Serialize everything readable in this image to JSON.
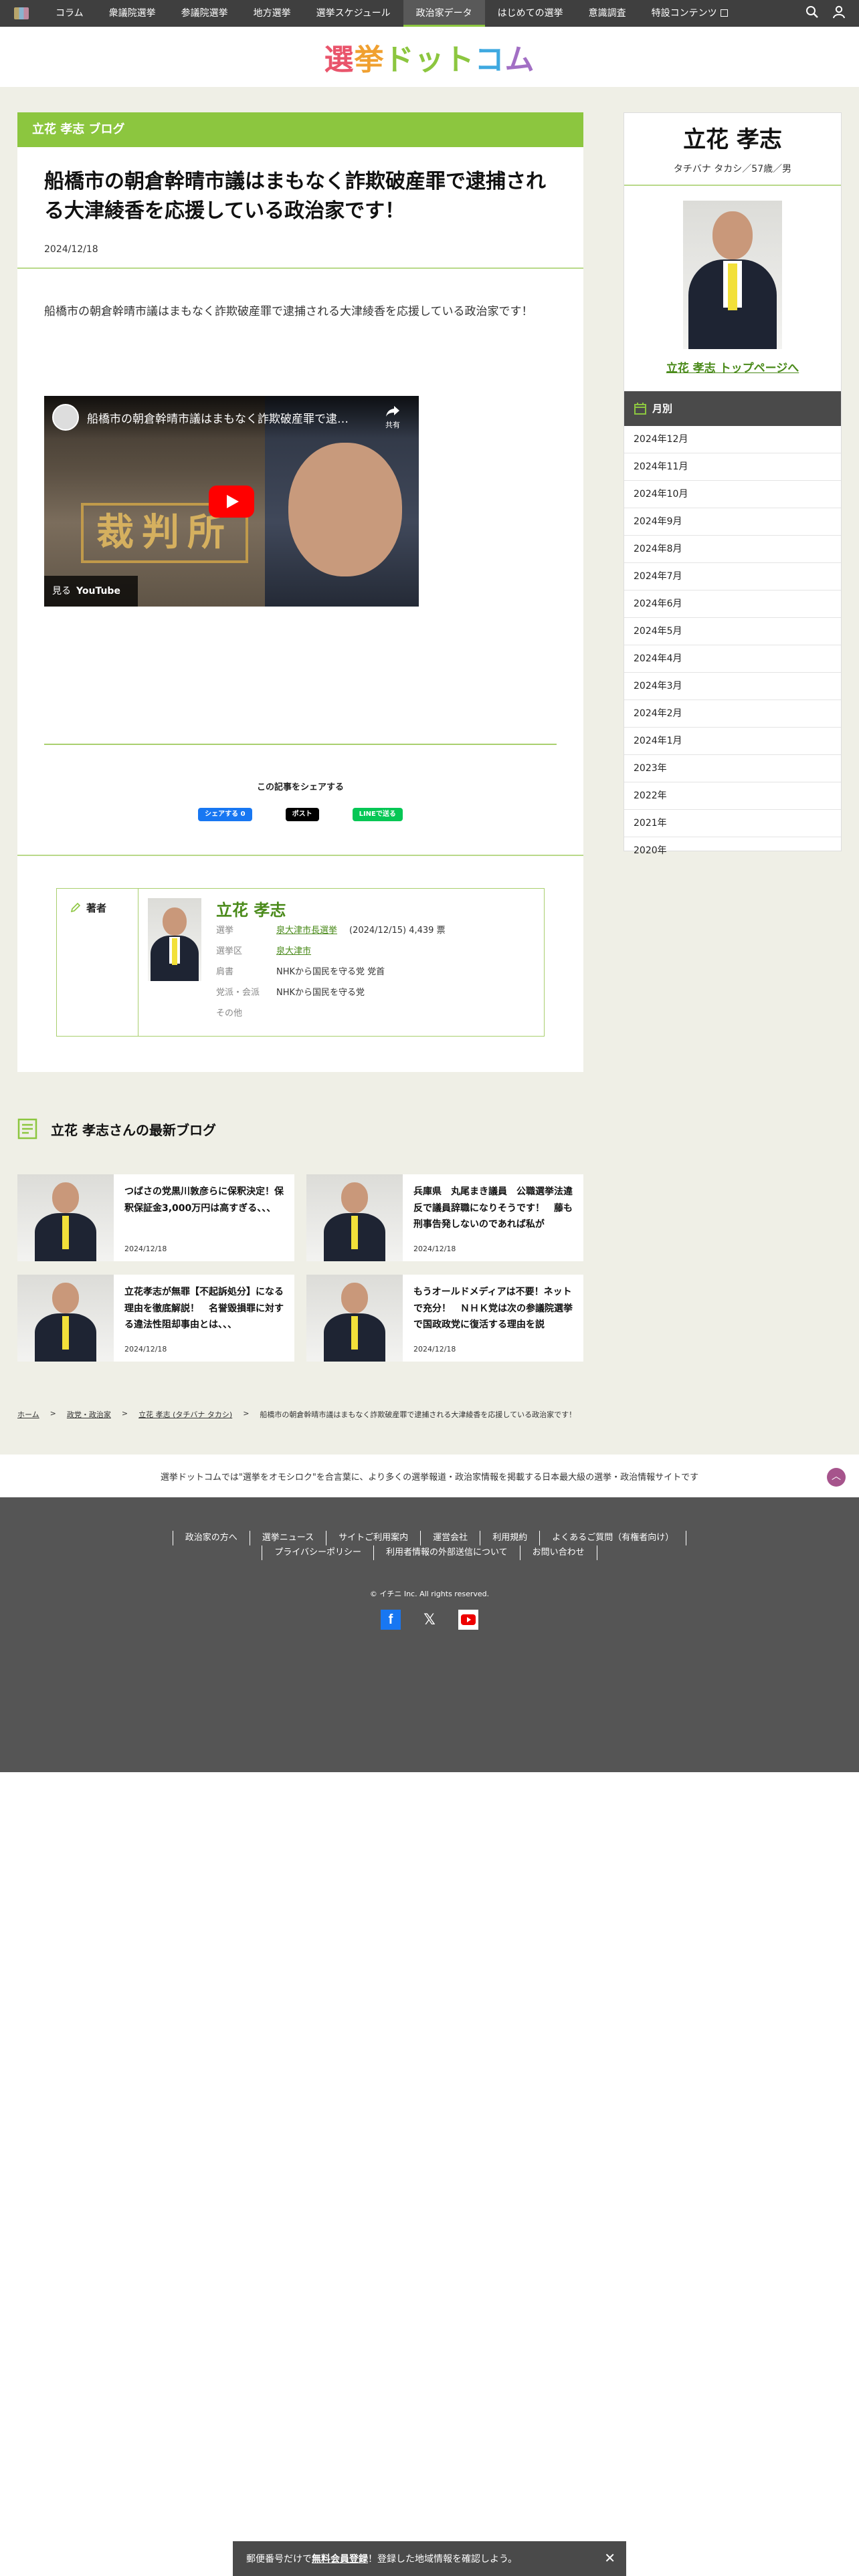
{
  "nav": {
    "items": [
      "コラム",
      "衆議院選挙",
      "参議院選挙",
      "地方選挙",
      "選挙スケジュール",
      "政治家データ",
      "はじめての選挙",
      "意識調査",
      "特設コンテンツ"
    ],
    "active_index": 5
  },
  "logo": {
    "parts": [
      "選",
      "挙",
      "ドット",
      "コ",
      "ム"
    ]
  },
  "article": {
    "blog_label": "立花 孝志 ブログ",
    "title": "船橋市の朝倉幹晴市議はまもなく詐欺破産罪で逮捕される大津綾香を応援している政治家です！",
    "date": "2024/12/18",
    "body": "船橋市の朝倉幹晴市議はまもなく詐欺破産罪で逮捕される大津綾香を応援している政治家です！",
    "video": {
      "title": "船橋市の朝倉幹晴市議はまもなく詐欺破産罪で逮…",
      "share_label": "共有",
      "watch_label": "見る",
      "youtube_label": "YouTube",
      "plaque_text": "裁判所"
    },
    "share_title": "この記事をシェアする",
    "share_buttons": {
      "facebook": "シェアする 0",
      "x": "ポスト",
      "line": "LINEで送る"
    }
  },
  "author": {
    "heading": "著者",
    "name": "立花 孝志",
    "labels": {
      "election": "選挙",
      "district": "選挙区",
      "party": "肩書",
      "faction": "党派・会派",
      "other": "その他"
    },
    "election_link": "泉大津市長選挙",
    "election_detail": "(2024/12/15) 4,439 票",
    "district": "泉大津市",
    "title_value": "NHKから国民を守る党 党首",
    "faction_value": "NHKから国民を守る党",
    "other_value": ""
  },
  "sidebar": {
    "name": "立花 孝志",
    "meta": "タチバナ タカシ／57歳／男",
    "top_link": "立花 孝志 トップページへ",
    "month_heading": "月別",
    "months": [
      "2024年12月",
      "2024年11月",
      "2024年10月",
      "2024年9月",
      "2024年8月",
      "2024年7月",
      "2024年6月",
      "2024年5月",
      "2024年4月",
      "2024年3月",
      "2024年2月",
      "2024年1月",
      "2023年",
      "2022年",
      "2021年",
      "2020年"
    ]
  },
  "latest": {
    "heading": "立花 孝志さんの最新ブログ",
    "cards": [
      {
        "title": "つばさの党黒川敦彦らに保釈決定！保釈保証金3,000万円は高すぎる、、、",
        "date": "2024/12/18"
      },
      {
        "title": "兵庫県　丸尾まき議員　公職選挙法違反で議員辞職になりそうです！　藤も刑事告発しないのであれば私が",
        "date": "2024/12/18"
      },
      {
        "title": "立花孝志が無罪【不起訴処分】になる理由を徹底解説！　名誉毀損罪に対する違法性阻却事由とは、、、",
        "date": "2024/12/18"
      },
      {
        "title": "もうオールドメディアは不要！ネットで充分！　ＮＨＫ党は次の参議院選挙で国政政党に復活する理由を説",
        "date": "2024/12/18"
      }
    ]
  },
  "breadcrumb": {
    "home": "ホーム",
    "politics": "政党・政治家",
    "person": "立花 孝志 (タチバナ タカシ)",
    "current": "船橋市の朝倉幹晴市議はまもなく詐欺破産罪で逮捕される大津綾香を応援している政治家です！",
    "sep": ">"
  },
  "tagline": "選挙ドットコムでは\"選挙をオモシロク\"を合言葉に、より多くの選挙報道・政治家情報を掲載する日本最大級の選挙・政治情報サイトです",
  "footer": {
    "links_row1": [
      "政治家の方へ",
      "選挙ニュース",
      "サイトご利用案内",
      "運営会社",
      "利用規約",
      "よくあるご質問（有権者向け）"
    ],
    "links_row2": [
      "プライバシーポリシー",
      "利用者情報の外部送信について",
      "お問い合わせ"
    ],
    "copyright": "© イチニ Inc. All rights reserved."
  },
  "bottom_bar": {
    "prefix": "郵便番号だけで",
    "register": "無料会員登録",
    "suffix": "！登録した地域情報を確認しよう。",
    "close": "✕"
  },
  "colors": {
    "accent_green": "#8cc63f",
    "link_green": "#4a8a1a",
    "nav_bg": "#3f3f3f",
    "footer_bg": "#555555"
  },
  "icons": [
    "grid-icon",
    "search-icon",
    "user-icon",
    "pencil-icon",
    "calendar-icon",
    "blog-list-icon",
    "facebook-icon",
    "x-icon",
    "youtube-icon",
    "close-icon",
    "arrow-up-icon"
  ]
}
